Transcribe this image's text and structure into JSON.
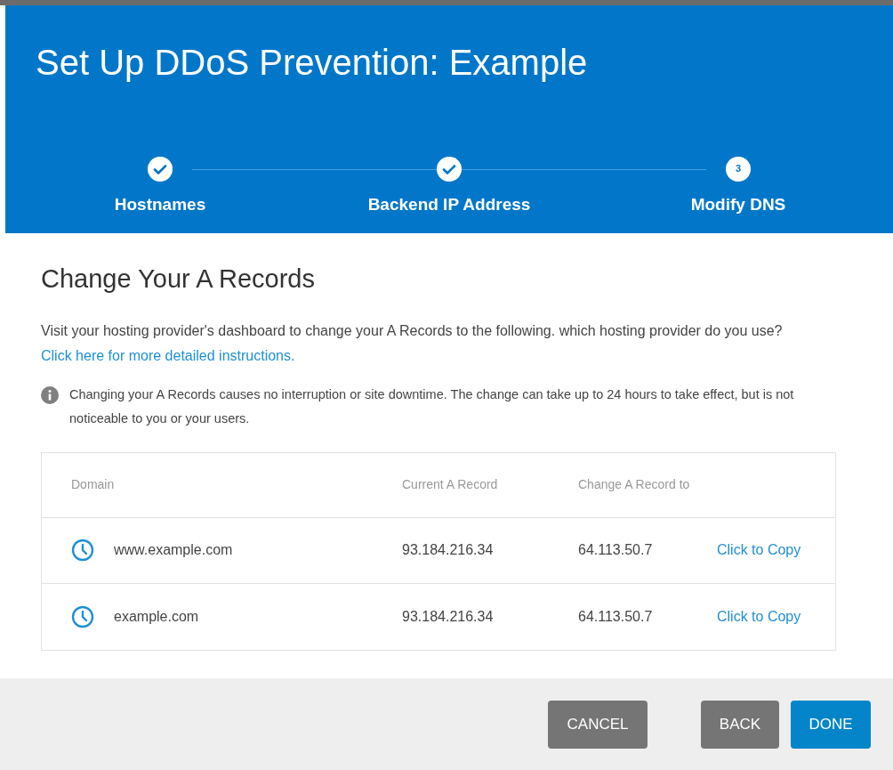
{
  "title": "Set Up DDoS Prevention: Example",
  "steps": [
    {
      "label": "Hostnames",
      "completed": true
    },
    {
      "label": "Backend IP Address",
      "completed": true
    },
    {
      "label": "Modify DNS",
      "completed": false,
      "number": "3"
    }
  ],
  "section_title": "Change Your A Records",
  "description": "Visit your hosting provider's dashboard to change your A Records to the following. which hosting provider do you use?",
  "instructions_link": "Click here for more detailed instructions.",
  "note": "Changing your A Records causes no interruption or site downtime. The change can take up to 24 hours to take effect, but is not noticeable to you or your users.",
  "table": {
    "columns": [
      "Domain",
      "Current A Record",
      "Change A Record to"
    ],
    "rows": [
      {
        "domain": "www.example.com",
        "current": "93.184.216.34",
        "new": "64.113.50.7",
        "action": "Click to Copy"
      },
      {
        "domain": "example.com",
        "current": "93.184.216.34",
        "new": "64.113.50.7",
        "action": "Click to Copy"
      }
    ]
  },
  "buttons": [
    {
      "label": "CANCEL",
      "kind": "secondary"
    },
    {
      "label": "BACK",
      "kind": "secondary"
    },
    {
      "label": "DONE",
      "kind": "primary"
    }
  ]
}
